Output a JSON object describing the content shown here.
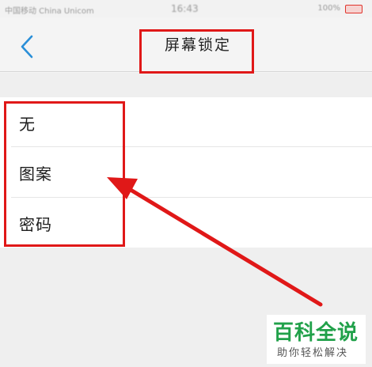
{
  "status_bar": {
    "left_text": "中国移动 China Unicom",
    "time": "16:43",
    "right_text": "100%",
    "battery_color": "#e0342c"
  },
  "header": {
    "back_icon": "chevron-left-icon",
    "title": "屏幕锁定"
  },
  "lock_options": [
    {
      "label": "无"
    },
    {
      "label": "图案"
    },
    {
      "label": "密码"
    }
  ],
  "annotation_color": "#e01818",
  "watermark": {
    "title": "百科全说",
    "subtitle": "助你轻松解决",
    "color": "#21a14a"
  }
}
